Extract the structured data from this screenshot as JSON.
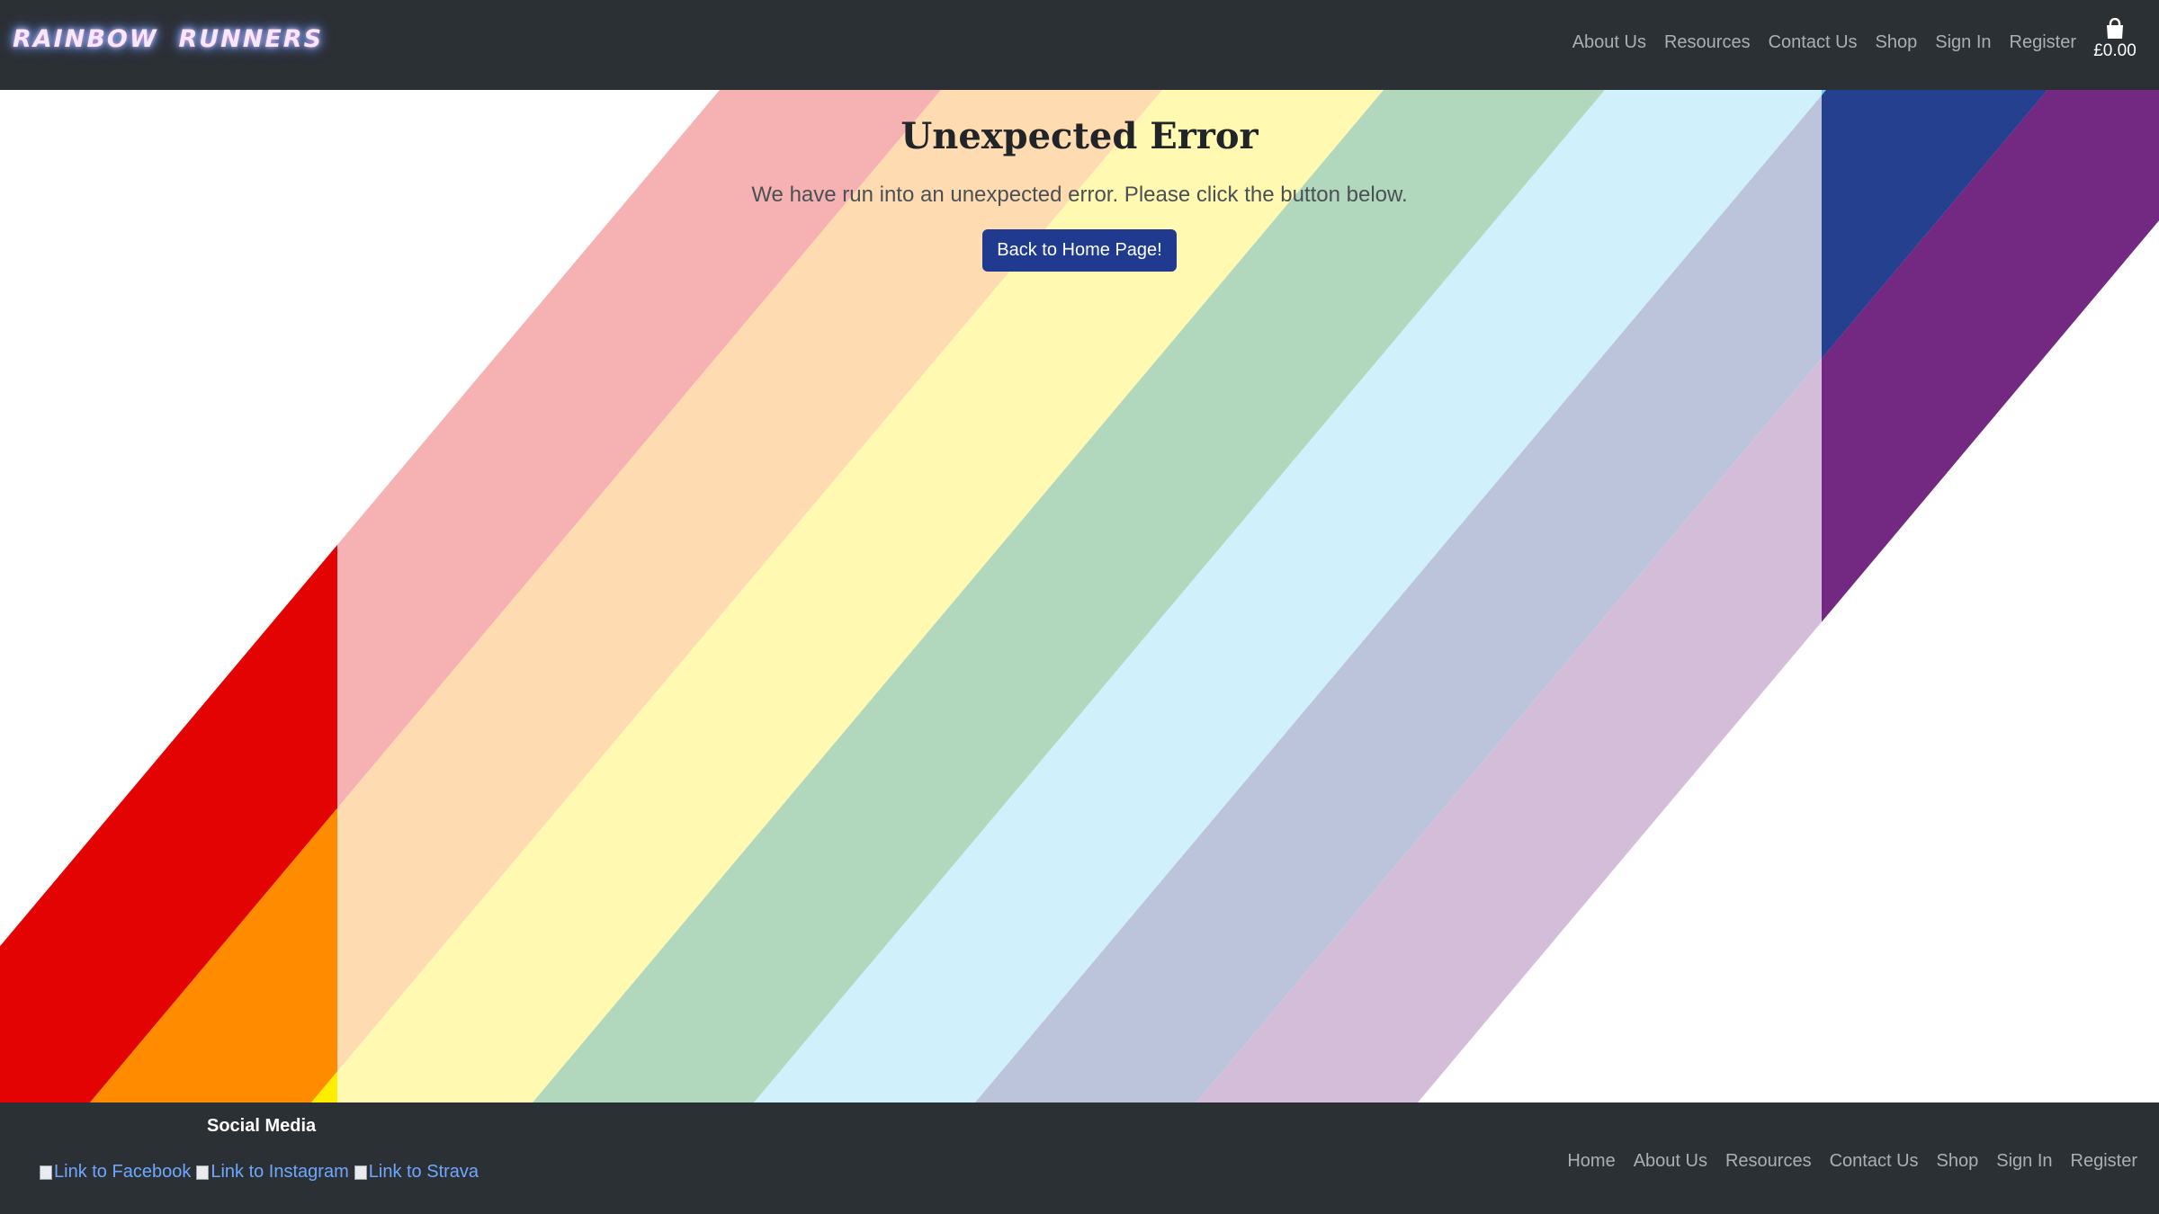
{
  "header": {
    "brand": "RAINBOW  RUNNERS",
    "nav": [
      "About Us",
      "Resources",
      "Contact Us",
      "Shop",
      "Sign In",
      "Register"
    ],
    "cart_icon": "shopping-bag-icon",
    "cart_total": "£0.00"
  },
  "main": {
    "title": "Unexpected Error",
    "message": "We have run into an unexpected error. Please click the button below.",
    "button_label": "Back to Home Page!",
    "stripe_colors": [
      "#e40303",
      "#ff8c00",
      "#ffed00",
      "#008026",
      "#66cef6",
      "#24408e",
      "#732982"
    ]
  },
  "footer": {
    "social_heading": "Social Media",
    "social_links": [
      "Link to Facebook",
      "Link to Instagram",
      "Link to Strava"
    ],
    "nav": [
      "Home",
      "About Us",
      "Resources",
      "Contact Us",
      "Shop",
      "Sign In",
      "Register"
    ]
  }
}
